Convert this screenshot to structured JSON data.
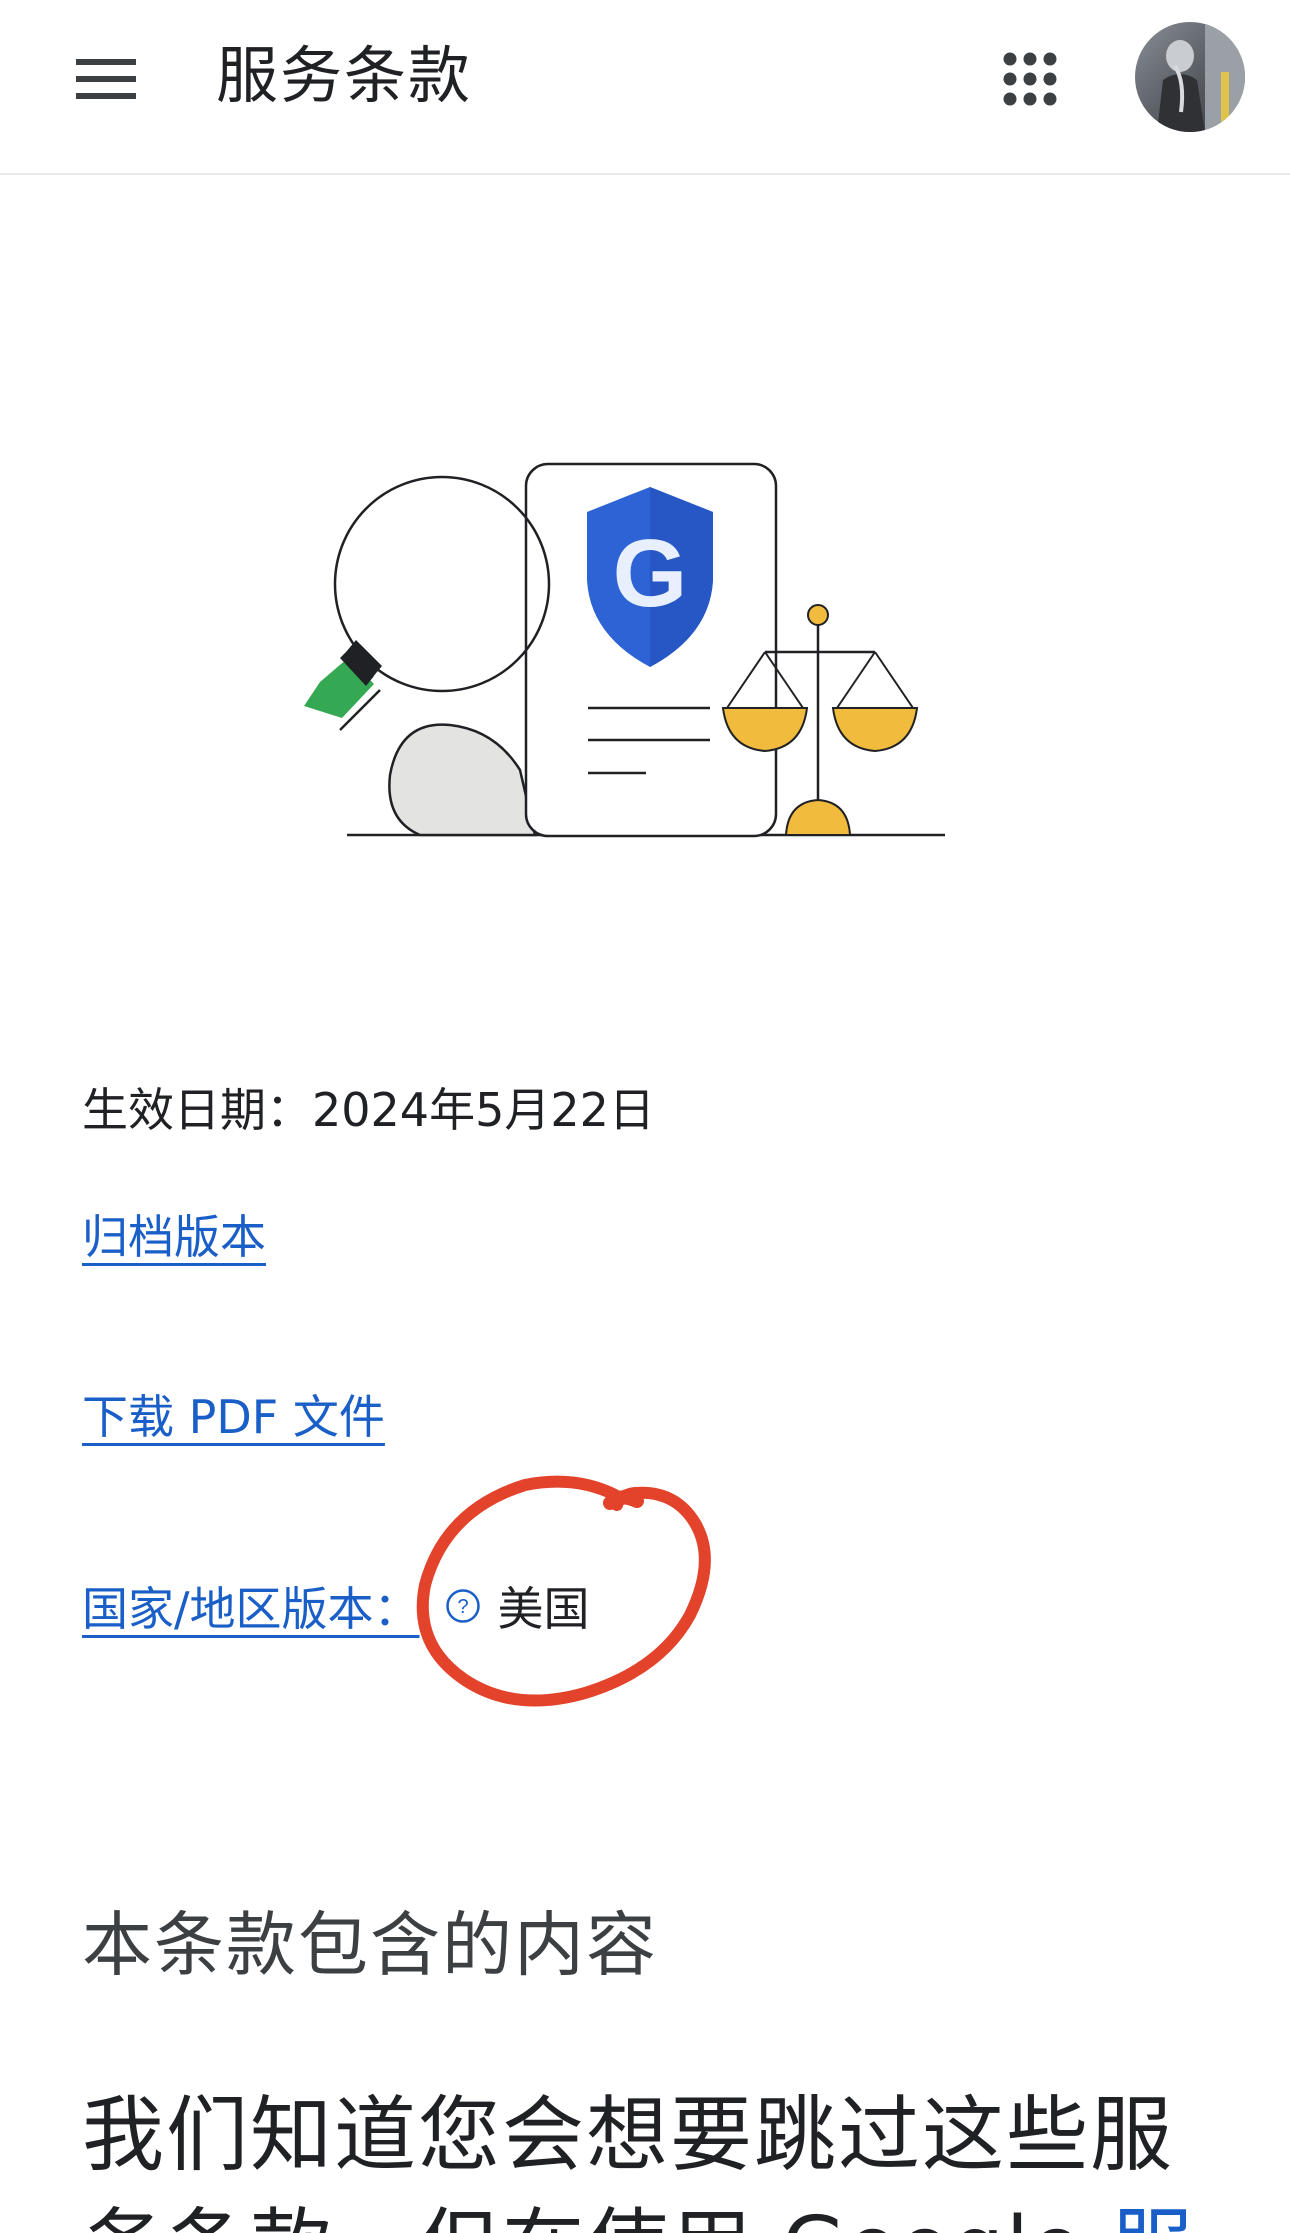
{
  "header": {
    "title": "服务条款",
    "menu_icon": "hamburger-menu-icon",
    "apps_icon": "apps-grid-icon",
    "avatar": "user-avatar"
  },
  "illustration": {
    "shield_letter": "G",
    "colors": {
      "shield": "#2d63d5",
      "scale": "#f1bb3d",
      "handle_green": "#34a853",
      "blob": "#e3e4e2"
    }
  },
  "content": {
    "effective_date": "生效日期：2024年5月22日",
    "archive_link": "归档版本",
    "pdf_link": "下载 PDF 文件",
    "country_label": "国家/地区版本：",
    "country_value": "美国",
    "section_heading": "本条款包含的内容",
    "lead_text": "我们知道您会想要跳过这些服务条款，但在使用 Google ",
    "lead_link": "服"
  },
  "colors": {
    "link": "#1a5fc7",
    "annotation": "#e2432a",
    "text": "#202124"
  }
}
